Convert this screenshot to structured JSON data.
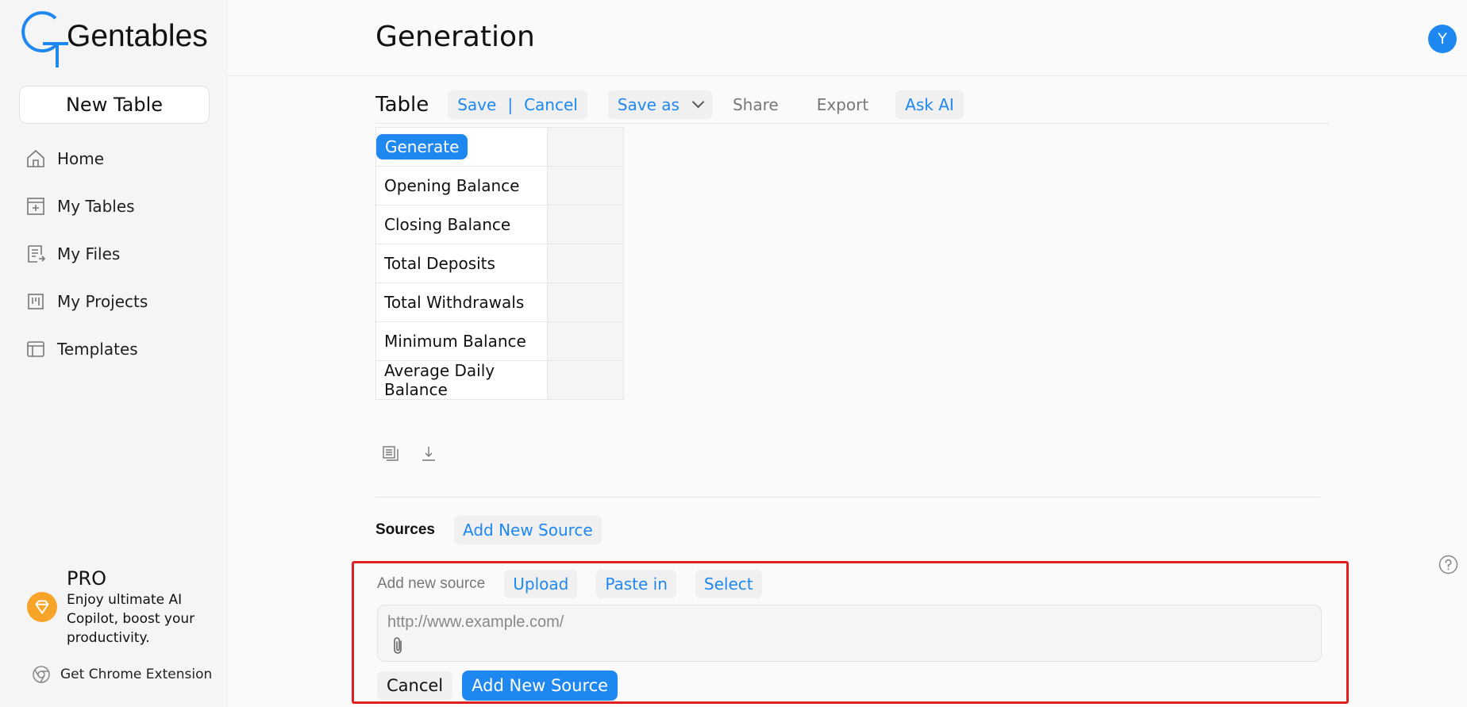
{
  "app": {
    "name": "Gentables"
  },
  "sidebar": {
    "new_table_label": "New Table",
    "items": [
      {
        "label": "Home",
        "icon": "home-icon"
      },
      {
        "label": "My Tables",
        "icon": "table-add-icon"
      },
      {
        "label": "My Files",
        "icon": "file-icon"
      },
      {
        "label": "My Projects",
        "icon": "project-icon"
      },
      {
        "label": "Templates",
        "icon": "template-icon"
      }
    ],
    "pro": {
      "title": "PRO",
      "description": "Enjoy ultimate AI Copilot, boost your productivity."
    },
    "chrome_extension_label": "Get Chrome Extension"
  },
  "header": {
    "title": "Generation",
    "avatar_initial": "Y"
  },
  "toolbar": {
    "table_label": "Table",
    "save_label": "Save",
    "separator": "|",
    "cancel_label": "Cancel",
    "save_as_label": "Save as",
    "share_label": "Share",
    "export_label": "Export",
    "ask_ai_label": "Ask AI"
  },
  "table": {
    "generate_label": "Generate",
    "rows": [
      "Opening Balance",
      "Closing Balance",
      "Total Deposits",
      "Total Withdrawals",
      "Minimum Balance",
      "Average Daily Balance"
    ]
  },
  "sources": {
    "label": "Sources",
    "add_new_source_label": "Add New Source",
    "panel": {
      "label": "Add new source",
      "upload_label": "Upload",
      "paste_in_label": "Paste in",
      "select_label": "Select",
      "url_placeholder": "http://www.example.com/",
      "cancel_label": "Cancel",
      "submit_label": "Add New Source"
    }
  },
  "colors": {
    "accent": "#1e88f0",
    "highlight_border": "#e02020",
    "pro_badge": "#f7a428"
  }
}
